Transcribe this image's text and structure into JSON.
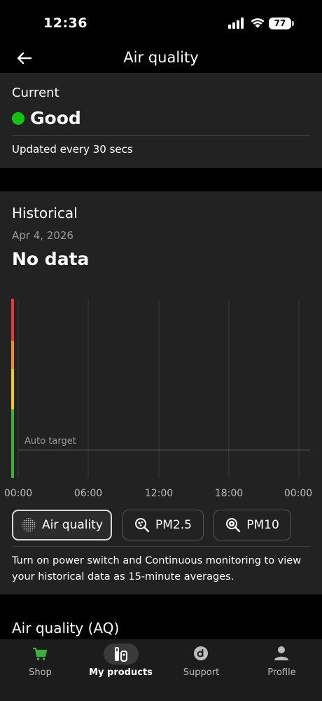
{
  "status_bar": {
    "time": "12:36",
    "battery": "77"
  },
  "header": {
    "title": "Air quality"
  },
  "current": {
    "label": "Current",
    "value": "Good",
    "updated": "Updated every 30 secs",
    "status_color": "#12c412"
  },
  "historical": {
    "label": "Historical",
    "date": "Apr 4, 2026",
    "value": "No data",
    "chart_data": {
      "type": "line",
      "x_ticks": [
        "00:00",
        "06:00",
        "12:00",
        "18:00",
        "00:00"
      ],
      "series": [],
      "annotation": "Auto target",
      "grid": true,
      "scale_colors": [
        "#e53935",
        "#f28c28",
        "#f2c811",
        "#3bb13b"
      ]
    },
    "tabs": [
      {
        "label": "Air quality",
        "icon": "air-quality-icon",
        "active": true
      },
      {
        "label": "PM2.5",
        "icon": "pm25-icon",
        "active": false
      },
      {
        "label": "PM10",
        "icon": "pm10-icon",
        "active": false
      }
    ],
    "note": "Turn on power switch and Continuous monitoring to view your historical data as 15-minute averages."
  },
  "aq_section": {
    "title": "Air quality (AQ)"
  },
  "nav": [
    {
      "label": "Shop",
      "icon": "cart-icon",
      "active": false
    },
    {
      "label": "My products",
      "icon": "my-products-icon",
      "active": true
    },
    {
      "label": "Support",
      "icon": "support-icon",
      "active": false
    },
    {
      "label": "Profile",
      "icon": "profile-icon",
      "active": false
    }
  ]
}
